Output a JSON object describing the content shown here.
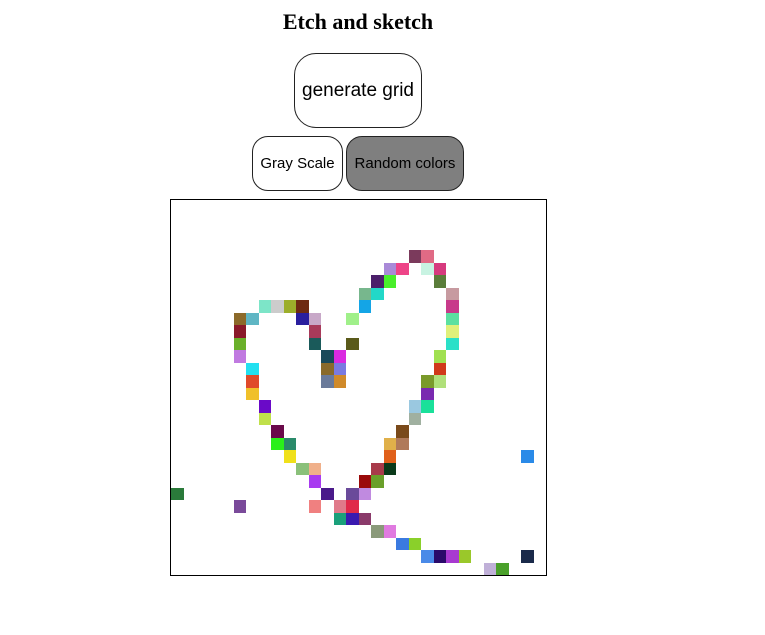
{
  "header": {
    "title": "Etch and sketch"
  },
  "controls": {
    "generate_label": "generate grid",
    "gray_label": "Gray Scale",
    "random_label": "Random colors"
  },
  "grid": {
    "rows": 30,
    "cols": 30,
    "painted": [
      [
        4,
        19,
        "#7b3a5c"
      ],
      [
        4,
        20,
        "#e06a85"
      ],
      [
        5,
        17,
        "#a98ad8"
      ],
      [
        5,
        18,
        "#ee4488"
      ],
      [
        5,
        20,
        "#c8f3e2"
      ],
      [
        5,
        21,
        "#d63a7e"
      ],
      [
        6,
        16,
        "#4b1f6a"
      ],
      [
        6,
        17,
        "#49ee2b"
      ],
      [
        6,
        21,
        "#5a7d3a"
      ],
      [
        7,
        15,
        "#77b78d"
      ],
      [
        7,
        16,
        "#22d8c8"
      ],
      [
        7,
        22,
        "#c79aa0"
      ],
      [
        8,
        7,
        "#7de5c8"
      ],
      [
        8,
        8,
        "#cccccc"
      ],
      [
        8,
        9,
        "#9cae2a"
      ],
      [
        8,
        10,
        "#6e2a12"
      ],
      [
        8,
        15,
        "#14a5e6"
      ],
      [
        8,
        22,
        "#c83a8a"
      ],
      [
        9,
        5,
        "#8c6a2a"
      ],
      [
        9,
        6,
        "#5fb6c4"
      ],
      [
        9,
        10,
        "#2a1f9e"
      ],
      [
        9,
        11,
        "#c8a8c8"
      ],
      [
        9,
        14,
        "#a0f08a"
      ],
      [
        9,
        22,
        "#5ce0a0"
      ],
      [
        10,
        5,
        "#8a1a2a"
      ],
      [
        10,
        11,
        "#a83a5a"
      ],
      [
        10,
        22,
        "#e0f07a"
      ],
      [
        11,
        5,
        "#6ab02a"
      ],
      [
        11,
        11,
        "#1a5a5a"
      ],
      [
        11,
        14,
        "#5a5a1a"
      ],
      [
        11,
        22,
        "#2ae0c8"
      ],
      [
        12,
        5,
        "#c07ae0"
      ],
      [
        12,
        12,
        "#1a4a5a"
      ],
      [
        12,
        13,
        "#da2ae0"
      ],
      [
        12,
        21,
        "#a0e050"
      ],
      [
        13,
        6,
        "#22e0f0"
      ],
      [
        13,
        12,
        "#8a6a2a"
      ],
      [
        13,
        13,
        "#7a7ae0"
      ],
      [
        13,
        21,
        "#d03a1a"
      ],
      [
        14,
        6,
        "#e04a2a"
      ],
      [
        14,
        12,
        "#6a7a9a"
      ],
      [
        14,
        13,
        "#d08a2a"
      ],
      [
        14,
        20,
        "#7a9a2a"
      ],
      [
        14,
        21,
        "#b0e07a"
      ],
      [
        15,
        6,
        "#f0c02a"
      ],
      [
        15,
        20,
        "#7a2ab0"
      ],
      [
        16,
        7,
        "#6a0ac8"
      ],
      [
        16,
        19,
        "#9ac8e0"
      ],
      [
        16,
        20,
        "#1ae09a"
      ],
      [
        17,
        7,
        "#c0e04a"
      ],
      [
        17,
        19,
        "#a0b0a0"
      ],
      [
        18,
        8,
        "#6a0a4a"
      ],
      [
        18,
        18,
        "#7a4a1a"
      ],
      [
        19,
        8,
        "#2af01a"
      ],
      [
        19,
        9,
        "#2a8a6a"
      ],
      [
        19,
        17,
        "#e0b04a"
      ],
      [
        19,
        18,
        "#b07a5a"
      ],
      [
        20,
        9,
        "#f0e01a"
      ],
      [
        20,
        17,
        "#e0601a"
      ],
      [
        20,
        28,
        "#2a8ae8"
      ],
      [
        21,
        10,
        "#8ac07a"
      ],
      [
        21,
        11,
        "#f0b08a"
      ],
      [
        21,
        16,
        "#a83a4a"
      ],
      [
        21,
        17,
        "#0a3a1a"
      ],
      [
        22,
        11,
        "#a83af0"
      ],
      [
        22,
        15,
        "#9a0a0a"
      ],
      [
        22,
        16,
        "#6aa02a"
      ],
      [
        23,
        0,
        "#2a7a3a"
      ],
      [
        23,
        12,
        "#4a1a8a"
      ],
      [
        23,
        14,
        "#6a4a9a"
      ],
      [
        23,
        15,
        "#c08ae0"
      ],
      [
        24,
        5,
        "#7a4a9a"
      ],
      [
        24,
        11,
        "#f08080"
      ],
      [
        24,
        13,
        "#e07a8a"
      ],
      [
        24,
        14,
        "#e02a4a"
      ],
      [
        25,
        13,
        "#1aa07a"
      ],
      [
        25,
        14,
        "#3a1ab0"
      ],
      [
        25,
        15,
        "#8a3a6a"
      ],
      [
        26,
        16,
        "#8a9a7a"
      ],
      [
        26,
        17,
        "#e07ae0"
      ],
      [
        27,
        18,
        "#3a7ae0"
      ],
      [
        27,
        19,
        "#8ad02a"
      ],
      [
        28,
        20,
        "#4a8ae8"
      ],
      [
        28,
        21,
        "#2a0a6a"
      ],
      [
        28,
        22,
        "#a83ad0"
      ],
      [
        28,
        23,
        "#9ac82a"
      ],
      [
        28,
        28,
        "#1a2a4a"
      ],
      [
        29,
        25,
        "#c0b0d8"
      ],
      [
        29,
        26,
        "#4aa02a"
      ]
    ]
  }
}
